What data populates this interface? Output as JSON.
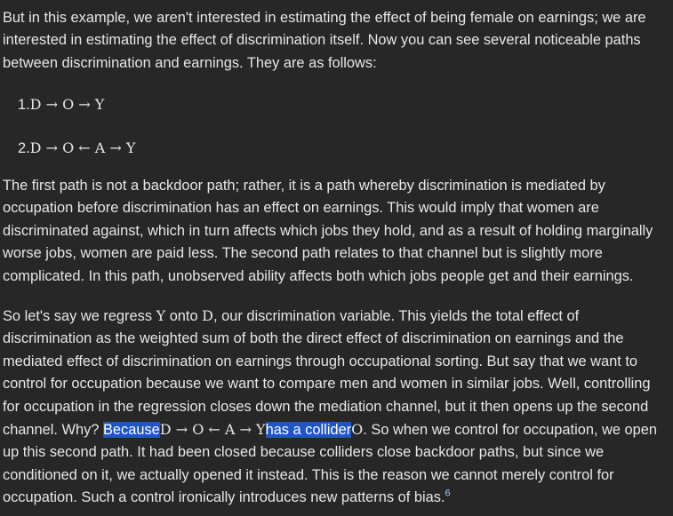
{
  "intro": {
    "text": "But in this example, we aren't interested in estimating the effect of being female on earnings; we are interested in estimating the effect of discrimination itself. Now you can see several noticeable paths between discrimination and earnings. They are as follows:"
  },
  "paths": [
    {
      "number": "1.",
      "expr": "D → O → Y"
    },
    {
      "number": "2.",
      "expr": "D → O ← A → Y"
    }
  ],
  "para2": {
    "text": "The first path is not a backdoor path; rather, it is a path whereby discrimination is mediated by occupation before discrimination has an effect on earnings. This would imply that women are discriminated against, which in turn affects which jobs they hold, and as a result of holding marginally worse jobs, women are paid less. The second path relates to that channel but is slightly more complicated. In this path, unobserved ability affects both which jobs people get and their earnings."
  },
  "para3": {
    "t1": "So let's say we regress ",
    "m1": "Y",
    "t2": " onto ",
    "m2": "D",
    "t3": ", our discrimination variable. This yields the total effect of discrimination as the weighted sum of both the direct effect of discrimination on earnings and the mediated effect of discrimination on earnings through occupational sorting. But say that we want to control for occupation because we want to compare men and women in similar jobs. Well, controlling for occupation in the regression closes down the mediation channel, but it then opens up the second channel. Why? ",
    "h1": "Because",
    "m3": "D → O ← A → Y",
    "h2": "has a collider",
    "m4": "O",
    "t4": ". So when we control for occupation, we open up this second path. It had been closed because colliders close backdoor paths, but since we conditioned on it, we actually opened it instead. This is the reason we cannot merely control for occupation. Such a control ironically introduces new patterns of bias.",
    "footnote": "6"
  },
  "colors": {
    "background": "#272727",
    "text": "#e6e6e6",
    "highlight": "#1e56c6",
    "footnote_link": "#a6c8ff"
  }
}
